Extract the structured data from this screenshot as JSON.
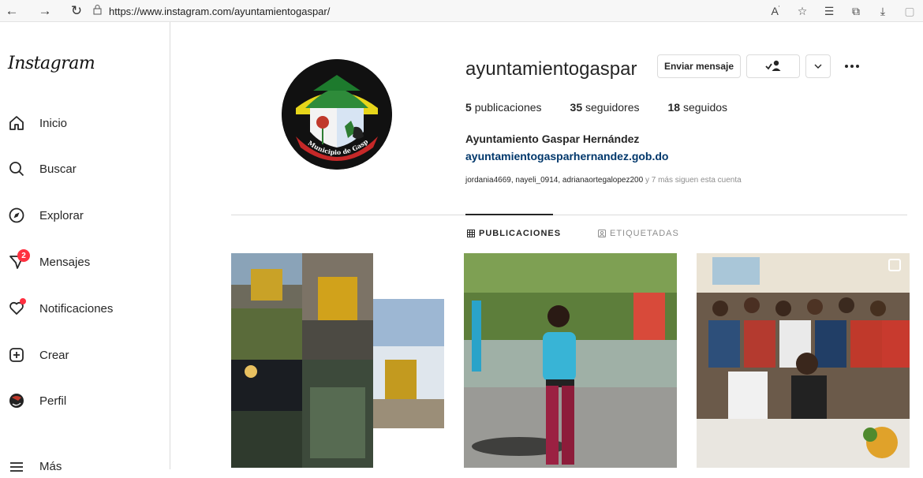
{
  "browser": {
    "url_host": "https://www.instagram.com",
    "url_path": "/ayuntamientogaspar/"
  },
  "sidebar": {
    "logo": "Instagram",
    "items": [
      {
        "label": "Inicio",
        "icon": "home-icon"
      },
      {
        "label": "Buscar",
        "icon": "search-icon"
      },
      {
        "label": "Explorar",
        "icon": "compass-icon"
      },
      {
        "label": "Mensajes",
        "icon": "messenger-icon",
        "badge": "2"
      },
      {
        "label": "Notificaciones",
        "icon": "heart-icon"
      },
      {
        "label": "Crear",
        "icon": "plus-square-icon"
      },
      {
        "label": "Perfil",
        "icon": "avatar-icon"
      },
      {
        "label": "Más",
        "icon": "menu-icon"
      }
    ]
  },
  "profile": {
    "username": "ayuntamientogaspar",
    "message_button": "Enviar mensaje",
    "posts_count": "5",
    "posts_label": "publicaciones",
    "followers_count": "35",
    "followers_label": "seguidores",
    "following_count": "18",
    "following_label": "seguidos",
    "full_name": "Ayuntamiento Gaspar Hernández",
    "website": "ayuntamientogasparhernandez.gob.do",
    "followed_by": "jordania4669, nayeli_0914, adrianaortegalopez200",
    "followed_more": "y 7 más siguen esta cuenta",
    "avatar_text": "Municipio de Gaspar Hernández"
  },
  "tabs": {
    "posts": "PUBLICACIONES",
    "tagged": "ETIQUETADAS"
  },
  "colors": {
    "link": "#00376b",
    "badge": "#ff3040",
    "border": "#dbdbdb"
  }
}
